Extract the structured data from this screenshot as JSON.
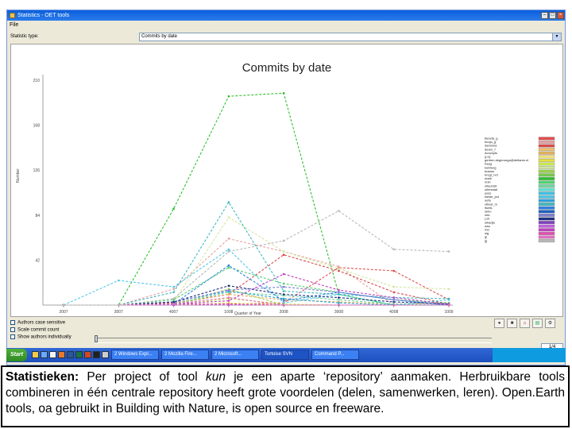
{
  "window": {
    "title": "Statistics - OET tools",
    "menu": [
      "File"
    ]
  },
  "controls": {
    "stat_type_label": "Statistic type:",
    "stat_type_value": "Commits by date",
    "checkboxes": [
      "Authors case sensitive",
      "Scale commit count",
      "Show authors individually"
    ],
    "number_value": "1/4"
  },
  "chart_data": {
    "type": "line",
    "title": "Commits by date",
    "xlabel": "Quarter of Year",
    "ylabel": "Number",
    "x": [
      "2007",
      "3007",
      "4007",
      "1008",
      "2008",
      "3008",
      "4008",
      "1009"
    ],
    "yticks": [
      "210",
      "168",
      "126",
      "84",
      "42"
    ],
    "ylim": [
      0,
      210
    ],
    "series": [
      {
        "values": [
          0,
          0,
          1,
          1,
          2,
          35,
          32,
          5
        ],
        "color": "#e05050"
      },
      {
        "values": [
          0,
          0,
          15,
          62,
          50,
          36,
          0,
          0
        ],
        "color": "#e8a0a0"
      },
      {
        "values": [
          0,
          0,
          2,
          10,
          47,
          32,
          12,
          1
        ],
        "color": "#d94a4a"
      },
      {
        "values": [
          0,
          0,
          0,
          0,
          0,
          0,
          0,
          0
        ],
        "color": "#f0c070"
      },
      {
        "values": [
          0,
          0,
          1,
          10,
          5,
          3,
          1,
          2
        ],
        "color": "#e0b060"
      },
      {
        "values": [
          0,
          0,
          0,
          0,
          0,
          0,
          0,
          0
        ],
        "color": "#f0e080"
      },
      {
        "values": [
          0,
          0,
          0,
          2,
          0,
          0,
          0,
          0
        ],
        "color": "#e6e040"
      },
      {
        "values": [
          0,
          0,
          0,
          6,
          1,
          0,
          0,
          0
        ],
        "color": "#c8e850"
      },
      {
        "values": [
          0,
          0,
          3,
          82,
          50,
          34,
          17,
          15
        ],
        "color": "#d0e8a0"
      },
      {
        "values": [
          0,
          0,
          0,
          15,
          0,
          0,
          0,
          0
        ],
        "color": "#9ad04a"
      },
      {
        "values": [
          0,
          0,
          0,
          0,
          0,
          0,
          0,
          0
        ],
        "color": "#78c850"
      },
      {
        "values": [
          0,
          0,
          90,
          195,
          198,
          10,
          0,
          0
        ],
        "color": "#30c030"
      },
      {
        "values": [
          0,
          0,
          5,
          35,
          20,
          12,
          5,
          2
        ],
        "color": "#50d070"
      },
      {
        "values": [
          0,
          0,
          1,
          12,
          9,
          5,
          1,
          0
        ],
        "color": "#70d8a0"
      },
      {
        "values": [
          0,
          0,
          0,
          0,
          0,
          0,
          0,
          0
        ],
        "color": "#60e0d0"
      },
      {
        "values": [
          0,
          0,
          0,
          0,
          0,
          0,
          0,
          0
        ],
        "color": "#40c0e0"
      },
      {
        "values": [
          0,
          23,
          17,
          52,
          2,
          10,
          0,
          5
        ],
        "color": "#50c8e8"
      },
      {
        "values": [
          0,
          0,
          3,
          13,
          6,
          2,
          0,
          0
        ],
        "color": "#30a0d8"
      },
      {
        "values": [
          0,
          0,
          12,
          96,
          13,
          10,
          7,
          6
        ],
        "color": "#40b8c0"
      },
      {
        "values": [
          0,
          0,
          1,
          37,
          4,
          12,
          5,
          0
        ],
        "color": "#3080e0"
      },
      {
        "values": [
          0,
          0,
          0,
          0,
          0,
          0,
          0,
          0
        ],
        "color": "#2060c0"
      },
      {
        "values": [
          0,
          0,
          3,
          14,
          17,
          12,
          5,
          0
        ],
        "color": "#8080d0"
      },
      {
        "values": [
          0,
          0,
          3,
          18,
          10,
          7,
          3,
          1
        ],
        "color": "#203080"
      },
      {
        "values": [
          0,
          0,
          0,
          0,
          0,
          0,
          0,
          0
        ],
        "color": "#8040c0"
      },
      {
        "values": [
          0,
          0,
          0,
          0,
          0,
          0,
          0,
          0
        ],
        "color": "#c060e0"
      },
      {
        "values": [
          0,
          0,
          1,
          4,
          29,
          14,
          7,
          1
        ],
        "color": "#c040c0"
      },
      {
        "values": [
          0,
          0,
          1,
          1,
          0,
          0,
          0,
          0
        ],
        "color": "#e050b0"
      },
      {
        "values": [
          0,
          0,
          1,
          7,
          0,
          0,
          0,
          0
        ],
        "color": "#e070c0"
      },
      {
        "values": [
          0,
          0,
          6,
          50,
          60,
          88,
          52,
          50
        ],
        "color": "#b8b8b8"
      }
    ],
    "legend": [
      "bkoefa_g",
      "bouju_g",
      "damsma",
      "dearo_f",
      "donchyts",
      "g.ey",
      "gerben.degeronga@deltares.nl",
      "haag",
      "kobberg",
      "kraans",
      "krogt_rvd",
      "mark",
      "mxb",
      "nitsuhdd",
      "uiterwaal",
      "yoss",
      "weide_jvd",
      "uefa",
      "vthesi_m",
      "lfoets",
      "skiro",
      "mkt",
      "j.sir",
      "ulkadja",
      "wsu",
      "rbd",
      "sig",
      "gl",
      "gj"
    ],
    "legend_placement": "right"
  },
  "taskbar": {
    "start_label": "Start",
    "tasks": [
      "2 Windows Expl...",
      "2 Mozilla Fire...",
      "2 Microsoft...",
      "Tortoise SVN",
      "Command P..."
    ],
    "quicklaunch": [
      "folder-icon",
      "explorer-icon",
      "mail-icon",
      "firefox-icon",
      "word-icon",
      "excel-icon",
      "ppt-icon",
      "terminal-icon",
      "calc-icon"
    ]
  },
  "caption": {
    "bold": "Statistieken:",
    "part1": " Per project of tool ",
    "italic": "kun",
    "part2": " je een aparte ‘repository’ aanmaken. Herbruikbare tools combineren in één centrale repository heeft grote voordelen (delen, samenwerken, leren). Open.Earth tools, oa gebruikt in Building with Nature, is open source en freeware."
  }
}
